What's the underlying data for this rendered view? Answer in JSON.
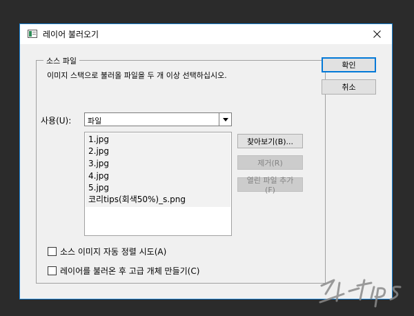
{
  "dialog": {
    "title": "레이어 불러오기",
    "close_glyph": "✕"
  },
  "source_group": {
    "legend": "소스 파일",
    "instruction": "이미지 스택으로 불러올 파일을 두 개 이상 선택하십시오.",
    "use_label": "사용(U):",
    "use_selected": "파일",
    "files": [
      "1.jpg",
      "2.jpg",
      "3.jpg",
      "4.jpg",
      "5.jpg",
      "코리tips(회색50%)_s.png"
    ],
    "browse_label": "찾아보기(B)...",
    "remove_label": "제거(R)",
    "add_open_label": "열린 파일 추가(F)"
  },
  "options": {
    "auto_align_label": "소스 이미지 자동 정렬 시도(A)",
    "auto_align_checked": false,
    "smart_object_label": "레이어를 불러온 후 고급 개체 만들기(C)",
    "smart_object_checked": false
  },
  "actions": {
    "ok_label": "확인",
    "cancel_label": "취소"
  },
  "colors": {
    "dialog_border": "#1883d7",
    "dialog_bg": "#f0f0f0",
    "backdrop": "#2b2b2b"
  }
}
